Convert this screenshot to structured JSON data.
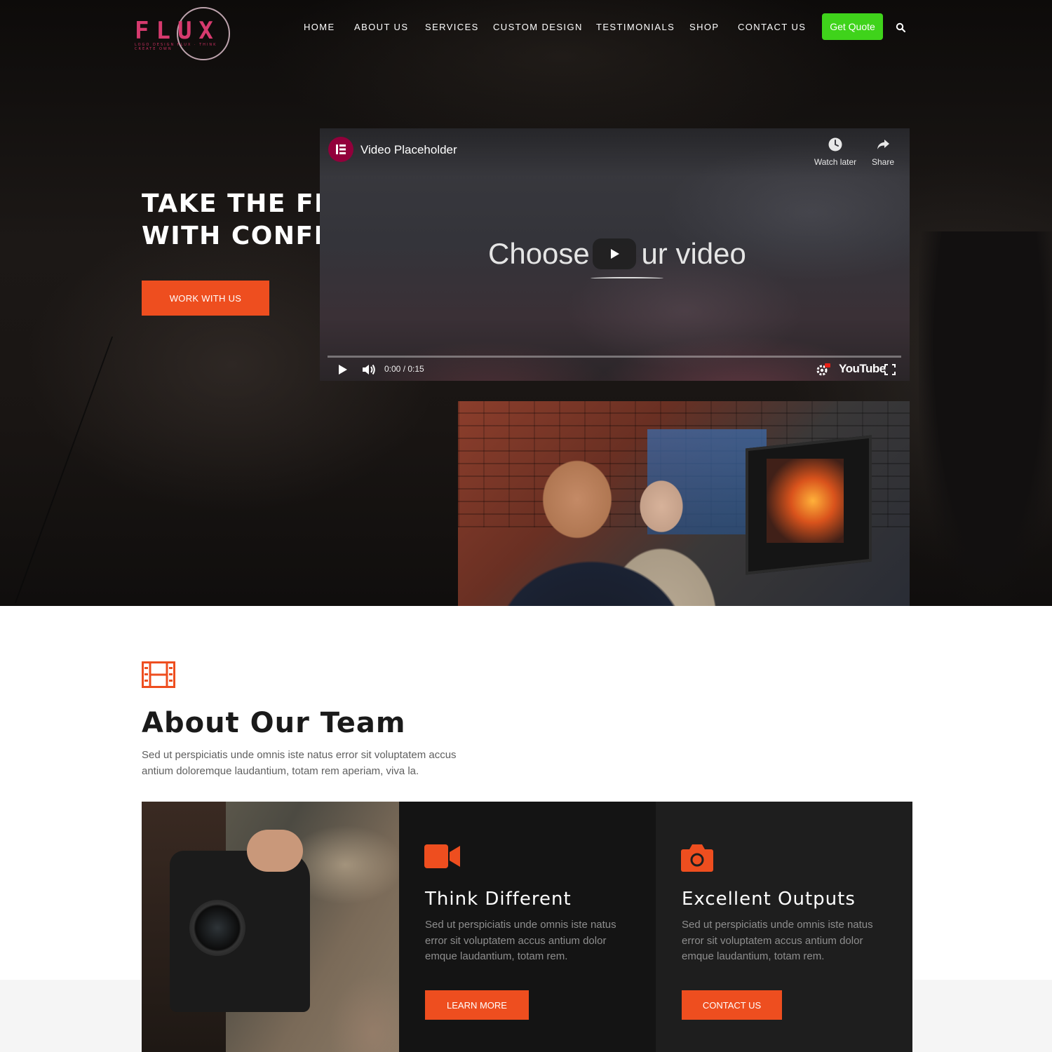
{
  "brand": {
    "logo_text": "FLUX",
    "logo_subtext": "LOGO DESIGN FLUX · THINK CREATE OWN",
    "logo_color": "#d63a6e"
  },
  "nav": {
    "items": [
      {
        "label": "HOME"
      },
      {
        "label": "ABOUT US"
      },
      {
        "label": "SERVICES"
      },
      {
        "label": "CUSTOM DESIGN"
      },
      {
        "label": "TESTIMONIALS"
      },
      {
        "label": "SHOP"
      },
      {
        "label": "CONTACT US"
      }
    ],
    "cta_label": "Get Quote",
    "cta_color": "#3fd31b",
    "search_icon": "search-icon"
  },
  "hero": {
    "title_line1": "TAKE THE FIELD",
    "title_line2": "WITH CONFIDENCE",
    "button_label": "WORK WITH US",
    "accent_color": "#ee4e1f"
  },
  "video": {
    "title": "Video Placeholder",
    "watch_later_label": "Watch later",
    "share_label": "Share",
    "overlay_text_before": "Choose ",
    "overlay_text_after": "ur video",
    "time": "0:00 / 0:15",
    "platform_logo": "YouTube",
    "progress": 0
  },
  "about": {
    "icon": "film-icon",
    "title": "About Our Team",
    "text": "Sed ut perspiciatis unde omnis iste natus error sit voluptatem accus antium doloremque laudantium, totam rem aperiam, viva la."
  },
  "features": [
    {
      "icon": "video-camera-icon",
      "title": "Think Different",
      "text": "Sed ut perspiciatis unde omnis iste natus error sit voluptatem accus antium dolor emque laudantium, totam rem.",
      "button_label": "LEARN MORE"
    },
    {
      "icon": "camera-icon",
      "title": "Excellent Outputs",
      "text": "Sed ut perspiciatis unde omnis iste natus error sit voluptatem accus antium dolor emque laudantium, totam rem.",
      "button_label": "CONTACT US"
    }
  ]
}
